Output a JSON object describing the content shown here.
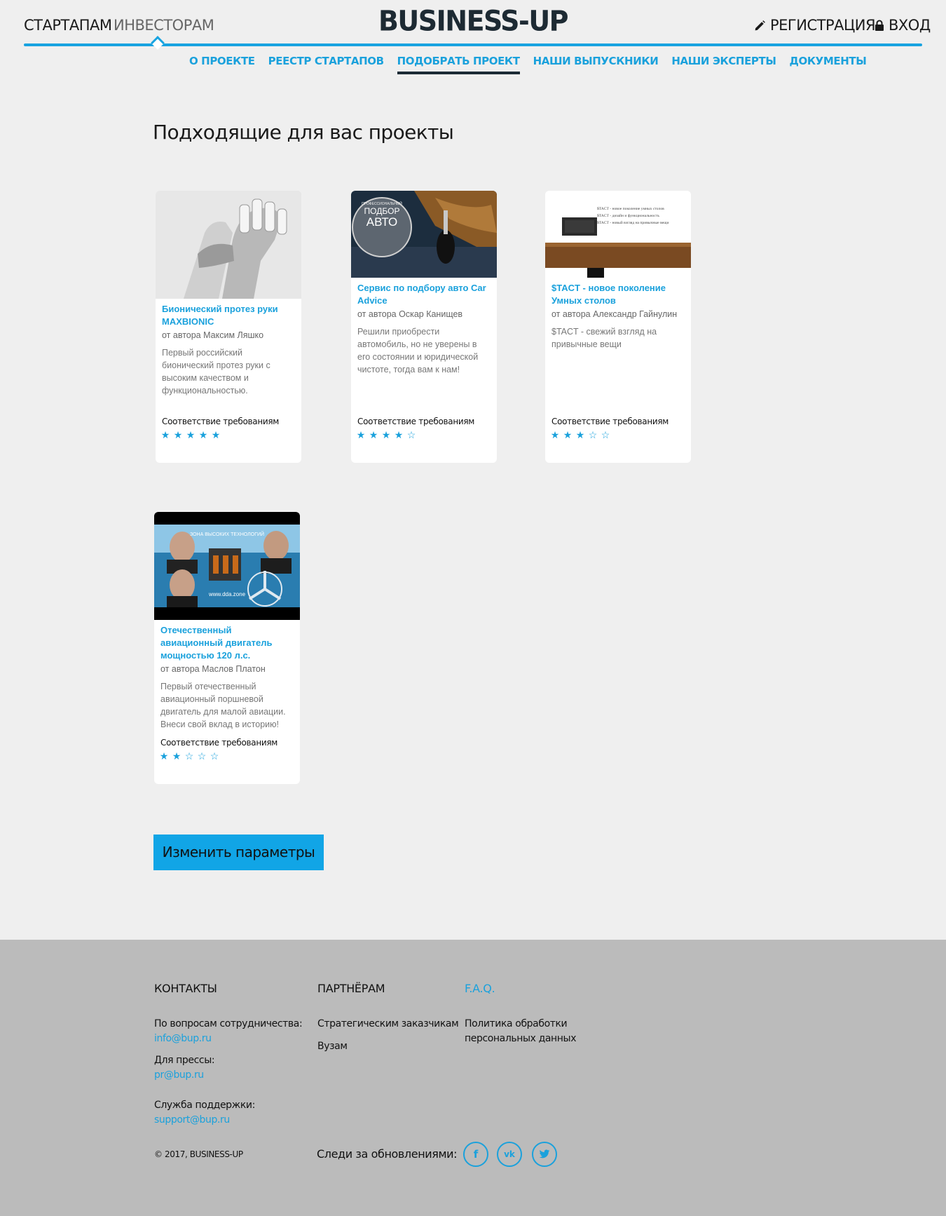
{
  "header": {
    "tab_startups": "СТАРТАПАМ",
    "tab_investors": "ИНВЕСТОРАМ",
    "logo": "BUSINESS-UP",
    "register": "РЕГИСТРАЦИЯ",
    "login": "ВХОД",
    "accent": "#18a3e0"
  },
  "subnav": [
    "О ПРОЕКТЕ",
    "РЕЕСТР СТАРТАПОВ",
    "ПОДОБРАТЬ ПРОЕКТ",
    "НАШИ ВЫПУСКНИКИ",
    "НАШИ ЭКСПЕРТЫ",
    "ДОКУМЕНТЫ"
  ],
  "subnav_current": "ПОДОБРАТЬ ПРОЕКТ",
  "page_title": "Подходящие для вас проекты",
  "match_label": "Соответствие требованиям",
  "projects": [
    {
      "title": "Бионический протез руки MAXBIONIC",
      "author": "от автора Максим Ляшко",
      "description": "Первый российский бионический протез руки с высоким качеством и функциональностью.",
      "rating": 5
    },
    {
      "title": "Сервис по подбору авто Car Advice",
      "author": "от автора Оскар Канищев",
      "description": "Решили приобрести автомобиль, но не уверены в его состоянии и юридической чистоте, тогда вам к нам!",
      "rating": 4,
      "image_text": [
        "ПРОФЕССИОНАЛЬНЫЙ",
        "ПОДБОР",
        "АВТО"
      ]
    },
    {
      "title": "$TACT - новое поколение Умных столов",
      "author": "от автора Александр Гайнулин",
      "description": "$TACT - свежий взгляд на привычные вещи",
      "rating": 3,
      "image_text": [
        "$TACT - новое поколение умных столов",
        "$TACT - дизайн и функциональность",
        "$TACT - новый взгляд на привычные вещи"
      ]
    },
    {
      "title": "Отечественный авиационный двигатель мощностью 120 л.с.",
      "author": "от автора Маслов Платон",
      "description": "Первый отечественный авиационный поршневой двигатель для малой авиации. Внеси свой вклад в историю!",
      "rating": 2,
      "image_text": [
        "ЗОНА ВЫСОКИХ ТЕХНОЛОГИЙ",
        "www.dda.zone"
      ]
    }
  ],
  "change_button": "Изменить параметры",
  "footer": {
    "contacts_heading": "КОНТАКТЫ",
    "partners_heading": "ПАРТНЁРАМ",
    "faq": "F.A.Q.",
    "coop_label": "По вопросам сотрудничества:",
    "coop_email": "info@bup.ru",
    "press_label": "Для прессы:",
    "press_email": "pr@bup.ru",
    "support_label": "Служба поддержки:",
    "support_email": "support@bup.ru",
    "partner_links": [
      "Стратегическим заказчикам",
      "Вузам"
    ],
    "privacy": "Политика обработки персональных данных",
    "copyright": "© 2017, BUSINESS-UP",
    "follow": "Следи за обновлениями:",
    "social": [
      "facebook",
      "vk",
      "twitter"
    ]
  }
}
